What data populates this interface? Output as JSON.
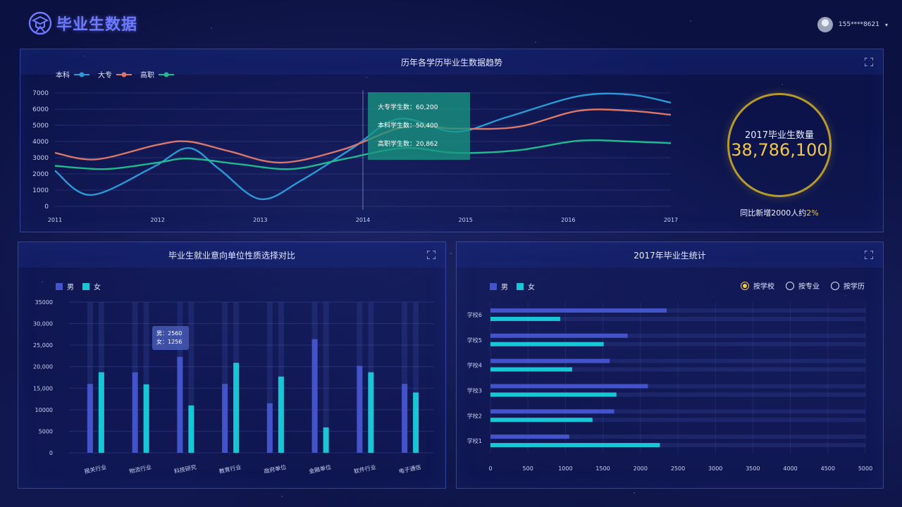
{
  "header": {
    "title": "毕业生数据",
    "user": "155****8621",
    "caret": "▾"
  },
  "trend": {
    "title": "历年各学历毕业生数据趋势",
    "legend": [
      {
        "name": "本科",
        "color": "#2a9ad6"
      },
      {
        "name": "大专",
        "color": "#d9786a"
      },
      {
        "name": "高职",
        "color": "#21b98f"
      }
    ],
    "tooltip": [
      "大专学生数：60,200",
      "本科学生数：50,400",
      "高职学生数：20,862"
    ],
    "chart_data": {
      "type": "line",
      "x": [
        "2011",
        "2012",
        "2013",
        "2014",
        "2015",
        "2016",
        "2017"
      ],
      "ylim": [
        0,
        7000
      ],
      "yticks": [
        0,
        1000,
        2000,
        3000,
        4000,
        5000,
        6000,
        7000
      ],
      "series": [
        {
          "name": "本科",
          "color": "#2a9ad6",
          "points": [
            [
              2011.0,
              2200
            ],
            [
              2011.35,
              700
            ],
            [
              2011.95,
              2400
            ],
            [
              2012.3,
              3600
            ],
            [
              2012.6,
              2300
            ],
            [
              2013.0,
              450
            ],
            [
              2013.4,
              1600
            ],
            [
              2013.9,
              3600
            ],
            [
              2014.35,
              5400
            ],
            [
              2014.9,
              4600
            ],
            [
              2015.4,
              5500
            ],
            [
              2016.1,
              6800
            ],
            [
              2016.6,
              6900
            ],
            [
              2017.0,
              6400
            ]
          ]
        },
        {
          "name": "大专",
          "color": "#d9786a",
          "points": [
            [
              2011.0,
              3300
            ],
            [
              2011.4,
              2900
            ],
            [
              2012.0,
              3800
            ],
            [
              2012.3,
              4000
            ],
            [
              2012.7,
              3400
            ],
            [
              2013.2,
              2700
            ],
            [
              2013.8,
              3500
            ],
            [
              2014.4,
              4900
            ],
            [
              2014.9,
              4800
            ],
            [
              2015.5,
              4900
            ],
            [
              2016.1,
              5900
            ],
            [
              2016.6,
              5900
            ],
            [
              2017.0,
              5650
            ]
          ]
        },
        {
          "name": "高职",
          "color": "#21b98f",
          "points": [
            [
              2011.0,
              2500
            ],
            [
              2011.5,
              2300
            ],
            [
              2012.0,
              2700
            ],
            [
              2012.3,
              2950
            ],
            [
              2012.8,
              2600
            ],
            [
              2013.3,
              2300
            ],
            [
              2013.8,
              2900
            ],
            [
              2014.4,
              3600
            ],
            [
              2014.9,
              3300
            ],
            [
              2015.5,
              3450
            ],
            [
              2016.1,
              4050
            ],
            [
              2016.6,
              4000
            ],
            [
              2017.0,
              3900
            ]
          ]
        }
      ],
      "highlight_x": 2014
    },
    "kpi": {
      "label": "2017毕业生数量",
      "value": "38,786,100",
      "sub_prefix": "同比新增2000人约",
      "sub_pct": "2%"
    }
  },
  "employ": {
    "title": "毕业生就业意向单位性质选择对比",
    "legend": [
      {
        "name": "男",
        "color": "#4353c9"
      },
      {
        "name": "女",
        "color": "#19c6d6"
      }
    ],
    "tooltip": [
      "男：2560",
      "女：1256"
    ],
    "chart_data": {
      "type": "bar",
      "categories": [
        "报关行业",
        "物流行业",
        "科技研究",
        "教育行业",
        "政府单位",
        "金融单位",
        "软件行业",
        "电子通信"
      ],
      "ylim": [
        0,
        35000
      ],
      "yticks": [
        "0",
        "5000",
        "10000",
        "15,000",
        "20,000",
        "25,000",
        "30,000",
        "35000"
      ],
      "series": [
        {
          "name": "男",
          "color": "#4353c9",
          "values": [
            16000,
            18700,
            22300,
            16000,
            11500,
            26400,
            20200,
            16000
          ]
        },
        {
          "name": "女",
          "color": "#19c6d6",
          "values": [
            18700,
            15900,
            11000,
            20900,
            17700,
            5900,
            18700,
            14000
          ]
        }
      ]
    }
  },
  "stats": {
    "title": "2017年毕业生统计",
    "legend": [
      {
        "name": "男",
        "color": "#4353c9"
      },
      {
        "name": "女",
        "color": "#19c6d6"
      }
    ],
    "radios": [
      {
        "label": "按学校",
        "checked": true
      },
      {
        "label": "按专业",
        "checked": false
      },
      {
        "label": "按学历",
        "checked": false
      }
    ],
    "chart_data": {
      "type": "bar",
      "orientation": "horizontal",
      "categories": [
        "学校6",
        "学校5",
        "学校4",
        "学校3",
        "学校2",
        "学校1"
      ],
      "xlim": [
        0,
        5000
      ],
      "xticks": [
        0,
        500,
        1000,
        1500,
        2000,
        2500,
        3000,
        3500,
        4000,
        4500,
        5000
      ],
      "series": [
        {
          "name": "男",
          "color": "#4353c9",
          "values": [
            2350,
            1830,
            1590,
            2100,
            1650,
            1050
          ]
        },
        {
          "name": "女",
          "color": "#19c6d6",
          "values": [
            930,
            1510,
            1090,
            1680,
            1360,
            2260
          ]
        }
      ]
    }
  }
}
